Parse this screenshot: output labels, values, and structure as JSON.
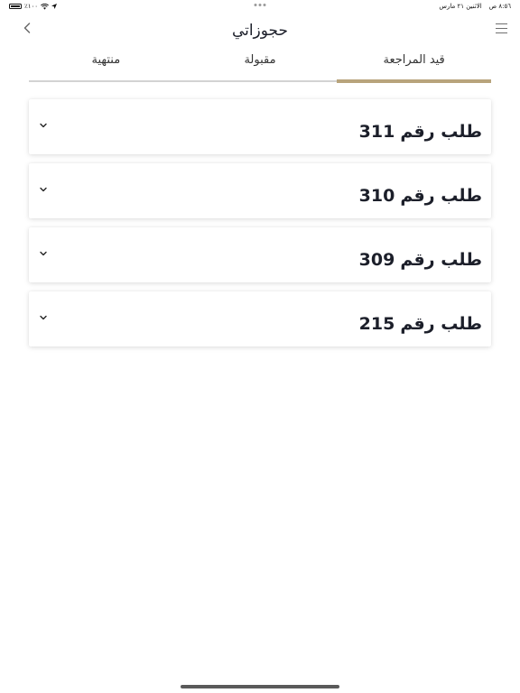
{
  "status_bar": {
    "battery": "٪١٠٠",
    "time": "٨:٥٦ ص",
    "date": "الاثنين ٢١ مارس"
  },
  "header": {
    "title": "حجوزاتي"
  },
  "tabs": [
    {
      "label": "قيد المراجعة",
      "active": true
    },
    {
      "label": "مقبولة",
      "active": false
    },
    {
      "label": "منتهية",
      "active": false
    }
  ],
  "requests": [
    {
      "label": "طلب رقم",
      "number": "311"
    },
    {
      "label": "طلب رقم",
      "number": "310"
    },
    {
      "label": "طلب رقم",
      "number": "309"
    },
    {
      "label": "طلب رقم",
      "number": "215"
    }
  ],
  "colors": {
    "accent": "#b8a47c",
    "text": "#1c1f2a"
  },
  "icons": [
    "menu-icon",
    "back-icon",
    "chevron-down-icon",
    "wifi-icon",
    "location-icon",
    "battery-icon"
  ]
}
